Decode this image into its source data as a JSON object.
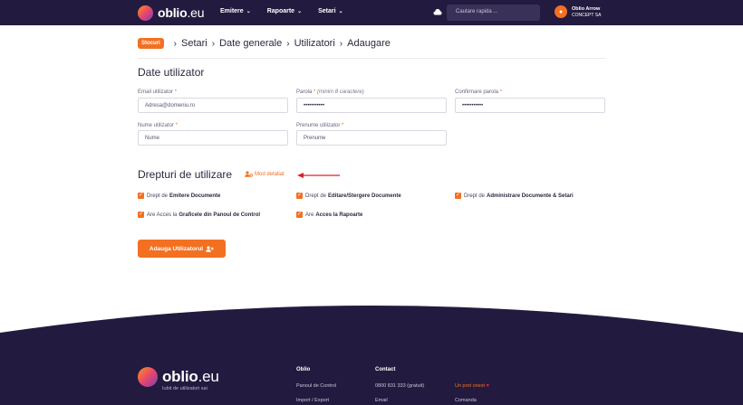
{
  "header": {
    "logo_name": "oblio",
    "logo_tld": ".eu",
    "nav": [
      {
        "label": "Emitere"
      },
      {
        "label": "Rapoarte"
      },
      {
        "label": "Setari"
      }
    ],
    "search_placeholder": "Cautare rapida ...",
    "account_name": "Oblio Arrow",
    "account_company": "CONCEPT SA"
  },
  "breadcrumb": {
    "badge": "Stocuri",
    "items": [
      "Setari",
      "Date generale",
      "Utilizatori",
      "Adaugare"
    ],
    "separator": "›"
  },
  "user_data": {
    "title": "Date utilizator",
    "email_label": "Email utilizator",
    "email_placeholder": "Adresa@domeniu.ro",
    "password_label": "Parola",
    "password_hint": "(minim 8 caractere)",
    "password_value": "•••••••••••",
    "confirm_label": "Confirmare parola",
    "confirm_value": "•••••••••••",
    "lastname_label": "Nume utilizator",
    "lastname_placeholder": "Nume",
    "firstname_label": "Prenume utilizator",
    "firstname_placeholder": "Prenume",
    "required_mark": "*"
  },
  "rights": {
    "title": "Drepturi de utilizare",
    "detailed_mode": "Mod detaliat",
    "permissions": [
      {
        "prefix": "Drept de",
        "bold": "Emitere Documente",
        "checked": true
      },
      {
        "prefix": "Drept de",
        "bold": "Editare/Stergere Documente",
        "checked": true
      },
      {
        "prefix": "Drept de",
        "bold": "Administrare Documente & Setari",
        "checked": true
      },
      {
        "prefix": "Are Acces la",
        "bold": "Graficele din Panoul de Control",
        "checked": true
      },
      {
        "prefix": "Are",
        "bold": "Acces la Rapoarte",
        "checked": true
      }
    ],
    "add_button": "Adauga Utilizatorul"
  },
  "footer": {
    "logo_name": "oblio",
    "logo_tld": ".eu",
    "tagline": "Iubit de utilizatori sai",
    "col1_title": "Oblio",
    "col1_links": [
      "Panoul de Control",
      "Import / Export"
    ],
    "col2_title": "Contact",
    "col2_links": [
      "0800 831 333 (gratuit)",
      "Email"
    ],
    "col3_links": [
      "Un pret onest",
      "Comanda"
    ]
  },
  "colors": {
    "brand_dark": "#231b3f",
    "accent": "#f37021",
    "arrow": "#d62027"
  }
}
